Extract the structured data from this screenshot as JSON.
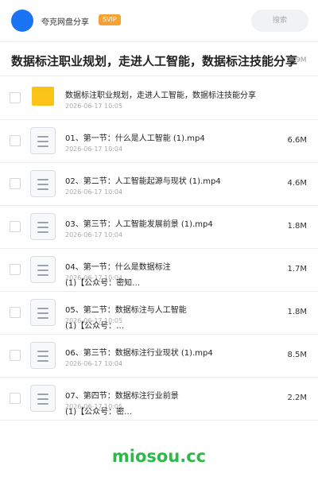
{
  "header": {
    "app_name": "夸克网盘分享",
    "badge": "SVIP",
    "search_placeholder": "搜索"
  },
  "folder_title": "数据标注职业规划，走进人工智能，数据标注技能分享",
  "folder_size": "9M",
  "items": [
    {
      "type": "folder",
      "name": "数据标注职业规划，走进人工智能，数据标注技能分享",
      "name2": "",
      "date": "2026-06-17 10:05",
      "size": ""
    },
    {
      "type": "file",
      "name": "01、第一节：什么是人工智能 (1).mp4",
      "name2": "",
      "date": "2026-06-17 10:04",
      "size": "6.6M"
    },
    {
      "type": "file",
      "name": "02、第二节：人工智能起源与现状 (1).mp4",
      "name2": "",
      "date": "2026-06-17 10:04",
      "size": "4.6M"
    },
    {
      "type": "file",
      "name": "03、第三节：人工智能发展前景 (1).mp4",
      "name2": "",
      "date": "2026-06-17 10:04",
      "size": "1.8M"
    },
    {
      "type": "file",
      "name": "04、第一节：什么是数据标注",
      "name2": "(1)【公众号：密知…",
      "date": "2026-06-17 10:04",
      "size": "1.7M"
    },
    {
      "type": "file",
      "name": "05、第二节：数据标注与人工智能",
      "name2": "(1)【公众号：…",
      "date": "2026-06-17 10:05",
      "size": "1.8M"
    },
    {
      "type": "file",
      "name": "06、第三节：数据标注行业现状 (1).mp4",
      "name2": "",
      "date": "2026-06-17 10:04",
      "size": "8.5M"
    },
    {
      "type": "file",
      "name": "07、第四节：数据标注行业前景",
      "name2": "(1)【公众号：密…",
      "date": "2026-06-17 10:05",
      "size": "2.2M"
    }
  ],
  "watermark": "miosou.cc",
  "colors": {
    "avatar": "#1a73f2",
    "svip": "#f7a034",
    "folder": "#fcc419",
    "watermark": "#2eb84a"
  }
}
